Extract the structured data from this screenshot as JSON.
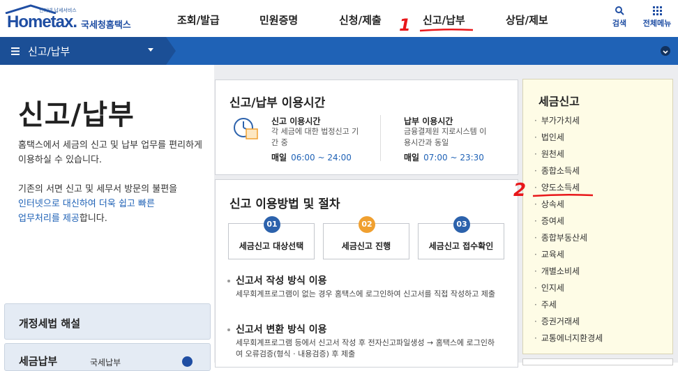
{
  "header": {
    "logo_tagline": "인터넷 납세서비스",
    "logo_text": "Hometax.",
    "logo_korean": "국세청홈택스",
    "nav": [
      "조회/발급",
      "민원증명",
      "신청/제출",
      "신고/납부",
      "상담/제보"
    ],
    "search_label": "검색",
    "allmenu_label": "전체메뉴"
  },
  "breadcrumb": {
    "label": "신고/납부"
  },
  "page": {
    "title": "신고/납부",
    "desc1": "홈택스에서 세금의 신고 및 납부 업무를 편리하게 이용하실 수 있습니다.",
    "desc2_a": "기존의 서면 신고 및 세무서 방문의 불편을",
    "desc2_b": "인터넷으로 대신하여 더욱 쉽고 빠른",
    "desc2_c": "업무처리를 제공",
    "desc2_d": "합니다.",
    "box1": "개정세법 해설",
    "box2": "세금납부",
    "box2_sub": "국세납부"
  },
  "hours": {
    "title": "신고/납부 이용시간",
    "report_label": "신고 이용시간",
    "report_sub": "각 세금에 대한 법정신고 기간 중",
    "report_day": "매일",
    "report_time": "06:00 ~ 24:00",
    "pay_label": "납부 이용시간",
    "pay_sub": "금융결제원 지로시스템 이용시간과 동일",
    "pay_day": "매일",
    "pay_time": "07:00 ~ 23:30"
  },
  "method": {
    "title": "신고 이용방법 및 절차",
    "steps": [
      {
        "num": "01",
        "label": "세금신고 대상선택",
        "color": "#2c62ac"
      },
      {
        "num": "02",
        "label": "세금신고 진행",
        "color": "#f0a030"
      },
      {
        "num": "03",
        "label": "세금신고 접수확인",
        "color": "#2c62ac"
      }
    ],
    "m1_title": "신고서 작성 방식 이용",
    "m1_desc": "세무회계프로그램이 없는 경우 홈택스에 로그인하여 신고서를 직접 작성하고 제출",
    "m2_title": "신고서 변환 방식 이용",
    "m2_desc": "세무회계프로그램 등에서 신고서 작성 후 전자신고파일생성 → 홈택스에 로그인하여 오류검증(형식 · 내용검증) 후 제출"
  },
  "taxes": {
    "title": "세금신고",
    "items": [
      "부가가치세",
      "법인세",
      "원천세",
      "종합소득세",
      "양도소득세",
      "상속세",
      "증여세",
      "종합부동산세",
      "교육세",
      "개별소비세",
      "인지세",
      "주세",
      "증권거래세",
      "교통에너지환경세"
    ]
  },
  "annotations": {
    "one": "1",
    "two": "2"
  }
}
